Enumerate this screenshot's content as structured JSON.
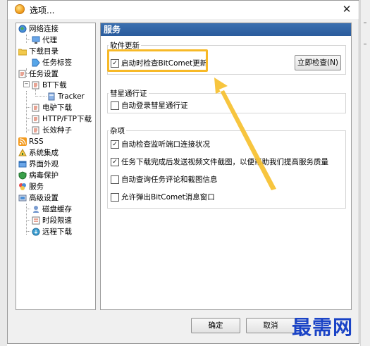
{
  "window": {
    "title": "选项..."
  },
  "tree": {
    "items": [
      {
        "label": "网络连接",
        "icon": "globe-icon"
      },
      {
        "label": "代理",
        "icon": "network-icon"
      },
      {
        "label": "下载目录",
        "icon": "folder-icon"
      },
      {
        "label": "任务标签",
        "icon": "tag-icon"
      },
      {
        "label": "任务设置",
        "icon": "task-icon"
      },
      {
        "label": "BT下载",
        "icon": "bt-icon"
      },
      {
        "label": "Tracker",
        "icon": "tracker-icon"
      },
      {
        "label": "电驴下载",
        "icon": "emule-icon"
      },
      {
        "label": "HTTP/FTP下载",
        "icon": "http-icon"
      },
      {
        "label": "长效种子",
        "icon": "seed-icon"
      },
      {
        "label": "RSS",
        "icon": "rss-icon"
      },
      {
        "label": "系统集成",
        "icon": "integration-icon"
      },
      {
        "label": "界面外观",
        "icon": "appearance-icon"
      },
      {
        "label": "病毒保护",
        "icon": "shield-icon"
      },
      {
        "label": "服务",
        "icon": "service-icon"
      },
      {
        "label": "高级设置",
        "icon": "advanced-icon"
      },
      {
        "label": "磁盘缓存",
        "icon": "disk-cache-icon"
      },
      {
        "label": "时段限速",
        "icon": "schedule-icon"
      },
      {
        "label": "远程下载",
        "icon": "remote-icon"
      }
    ]
  },
  "panel": {
    "header": "服务",
    "software_update": {
      "title": "软件更新",
      "check_on_start": "启动时检查BitComet更新",
      "check_on_start_checked": true,
      "check_now_button": "立即检查(N)"
    },
    "comet_pass": {
      "title": "彗星通行证",
      "auto_login": "自动登录彗星通行证",
      "auto_login_checked": false
    },
    "misc": {
      "title": "杂项",
      "options": [
        {
          "label": "自动检查监听端口连接状况",
          "checked": true
        },
        {
          "label": "任务下载完成后发送视频文件截图，以便帮助我们提高服务质量",
          "checked": true
        },
        {
          "label": "自动查询任务评论和截图信息",
          "checked": false
        },
        {
          "label": "允许弹出BitComet消息窗口",
          "checked": false
        }
      ]
    }
  },
  "buttons": {
    "ok": "确定",
    "cancel": "取消"
  },
  "watermark": "最需网",
  "colors": {
    "header_bg": "#2f62a6",
    "highlight": "#f7b927",
    "watermark": "#1a43c6"
  }
}
